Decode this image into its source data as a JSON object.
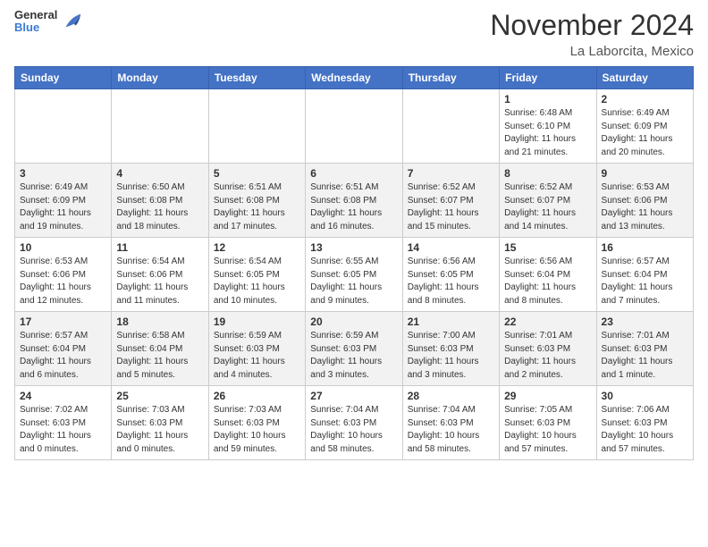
{
  "header": {
    "logo": {
      "general": "General",
      "blue": "Blue"
    },
    "title": "November 2024",
    "location": "La Laborcita, Mexico"
  },
  "calendar": {
    "days_of_week": [
      "Sunday",
      "Monday",
      "Tuesday",
      "Wednesday",
      "Thursday",
      "Friday",
      "Saturday"
    ],
    "weeks": [
      [
        {
          "num": "",
          "info": ""
        },
        {
          "num": "",
          "info": ""
        },
        {
          "num": "",
          "info": ""
        },
        {
          "num": "",
          "info": ""
        },
        {
          "num": "",
          "info": ""
        },
        {
          "num": "1",
          "info": "Sunrise: 6:48 AM\nSunset: 6:10 PM\nDaylight: 11 hours and 21 minutes."
        },
        {
          "num": "2",
          "info": "Sunrise: 6:49 AM\nSunset: 6:09 PM\nDaylight: 11 hours and 20 minutes."
        }
      ],
      [
        {
          "num": "3",
          "info": "Sunrise: 6:49 AM\nSunset: 6:09 PM\nDaylight: 11 hours and 19 minutes."
        },
        {
          "num": "4",
          "info": "Sunrise: 6:50 AM\nSunset: 6:08 PM\nDaylight: 11 hours and 18 minutes."
        },
        {
          "num": "5",
          "info": "Sunrise: 6:51 AM\nSunset: 6:08 PM\nDaylight: 11 hours and 17 minutes."
        },
        {
          "num": "6",
          "info": "Sunrise: 6:51 AM\nSunset: 6:08 PM\nDaylight: 11 hours and 16 minutes."
        },
        {
          "num": "7",
          "info": "Sunrise: 6:52 AM\nSunset: 6:07 PM\nDaylight: 11 hours and 15 minutes."
        },
        {
          "num": "8",
          "info": "Sunrise: 6:52 AM\nSunset: 6:07 PM\nDaylight: 11 hours and 14 minutes."
        },
        {
          "num": "9",
          "info": "Sunrise: 6:53 AM\nSunset: 6:06 PM\nDaylight: 11 hours and 13 minutes."
        }
      ],
      [
        {
          "num": "10",
          "info": "Sunrise: 6:53 AM\nSunset: 6:06 PM\nDaylight: 11 hours and 12 minutes."
        },
        {
          "num": "11",
          "info": "Sunrise: 6:54 AM\nSunset: 6:06 PM\nDaylight: 11 hours and 11 minutes."
        },
        {
          "num": "12",
          "info": "Sunrise: 6:54 AM\nSunset: 6:05 PM\nDaylight: 11 hours and 10 minutes."
        },
        {
          "num": "13",
          "info": "Sunrise: 6:55 AM\nSunset: 6:05 PM\nDaylight: 11 hours and 9 minutes."
        },
        {
          "num": "14",
          "info": "Sunrise: 6:56 AM\nSunset: 6:05 PM\nDaylight: 11 hours and 8 minutes."
        },
        {
          "num": "15",
          "info": "Sunrise: 6:56 AM\nSunset: 6:04 PM\nDaylight: 11 hours and 8 minutes."
        },
        {
          "num": "16",
          "info": "Sunrise: 6:57 AM\nSunset: 6:04 PM\nDaylight: 11 hours and 7 minutes."
        }
      ],
      [
        {
          "num": "17",
          "info": "Sunrise: 6:57 AM\nSunset: 6:04 PM\nDaylight: 11 hours and 6 minutes."
        },
        {
          "num": "18",
          "info": "Sunrise: 6:58 AM\nSunset: 6:04 PM\nDaylight: 11 hours and 5 minutes."
        },
        {
          "num": "19",
          "info": "Sunrise: 6:59 AM\nSunset: 6:03 PM\nDaylight: 11 hours and 4 minutes."
        },
        {
          "num": "20",
          "info": "Sunrise: 6:59 AM\nSunset: 6:03 PM\nDaylight: 11 hours and 3 minutes."
        },
        {
          "num": "21",
          "info": "Sunrise: 7:00 AM\nSunset: 6:03 PM\nDaylight: 11 hours and 3 minutes."
        },
        {
          "num": "22",
          "info": "Sunrise: 7:01 AM\nSunset: 6:03 PM\nDaylight: 11 hours and 2 minutes."
        },
        {
          "num": "23",
          "info": "Sunrise: 7:01 AM\nSunset: 6:03 PM\nDaylight: 11 hours and 1 minute."
        }
      ],
      [
        {
          "num": "24",
          "info": "Sunrise: 7:02 AM\nSunset: 6:03 PM\nDaylight: 11 hours and 0 minutes."
        },
        {
          "num": "25",
          "info": "Sunrise: 7:03 AM\nSunset: 6:03 PM\nDaylight: 11 hours and 0 minutes."
        },
        {
          "num": "26",
          "info": "Sunrise: 7:03 AM\nSunset: 6:03 PM\nDaylight: 10 hours and 59 minutes."
        },
        {
          "num": "27",
          "info": "Sunrise: 7:04 AM\nSunset: 6:03 PM\nDaylight: 10 hours and 58 minutes."
        },
        {
          "num": "28",
          "info": "Sunrise: 7:04 AM\nSunset: 6:03 PM\nDaylight: 10 hours and 58 minutes."
        },
        {
          "num": "29",
          "info": "Sunrise: 7:05 AM\nSunset: 6:03 PM\nDaylight: 10 hours and 57 minutes."
        },
        {
          "num": "30",
          "info": "Sunrise: 7:06 AM\nSunset: 6:03 PM\nDaylight: 10 hours and 57 minutes."
        }
      ]
    ]
  }
}
